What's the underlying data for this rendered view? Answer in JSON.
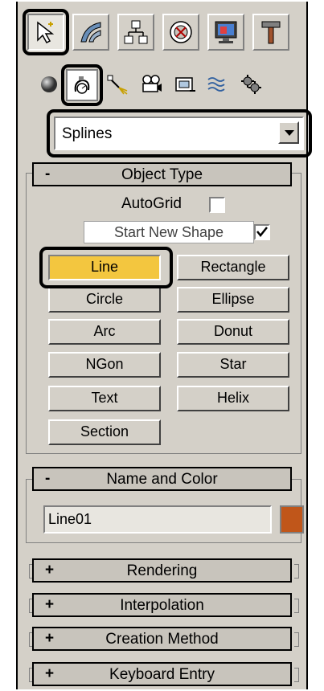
{
  "colors": {
    "panel_bg": "#d4d0c8",
    "selected_button": "#f3c63f",
    "object_color": "#c0561a"
  },
  "tabs": [
    {
      "name": "create",
      "icon": "create-cursor-icon"
    },
    {
      "name": "modify",
      "icon": "modify-bend-icon"
    },
    {
      "name": "hierarchy",
      "icon": "hierarchy-icon"
    },
    {
      "name": "motion",
      "icon": "motion-icon"
    },
    {
      "name": "display",
      "icon": "display-monitor-icon"
    },
    {
      "name": "utilities",
      "icon": "utilities-hammer-icon"
    }
  ],
  "subcategories": [
    {
      "name": "geometry",
      "icon": "sphere-icon"
    },
    {
      "name": "shapes",
      "icon": "shapes-icon"
    },
    {
      "name": "lights",
      "icon": "light-icon"
    },
    {
      "name": "cameras",
      "icon": "camera-icon"
    },
    {
      "name": "helpers",
      "icon": "helper-tape-icon"
    },
    {
      "name": "space_warps",
      "icon": "space-warp-icon"
    },
    {
      "name": "systems",
      "icon": "systems-gear-icon"
    }
  ],
  "category_dropdown": {
    "value": "Splines"
  },
  "object_type": {
    "header_sign": "-",
    "title": "Object Type",
    "autogrid_label": "AutoGrid",
    "start_new_shape_label": "Start New Shape",
    "buttons": [
      "Line",
      "Rectangle",
      "Circle",
      "Ellipse",
      "Arc",
      "Donut",
      "NGon",
      "Star",
      "Text",
      "Helix",
      "Section"
    ]
  },
  "name_and_color": {
    "header_sign": "-",
    "title": "Name and Color",
    "name_value": "Line01"
  },
  "collapsed_rollouts": [
    {
      "sign": "+",
      "title": "Rendering"
    },
    {
      "sign": "+",
      "title": "Interpolation"
    },
    {
      "sign": "+",
      "title": "Creation Method"
    },
    {
      "sign": "+",
      "title": "Keyboard Entry"
    }
  ]
}
